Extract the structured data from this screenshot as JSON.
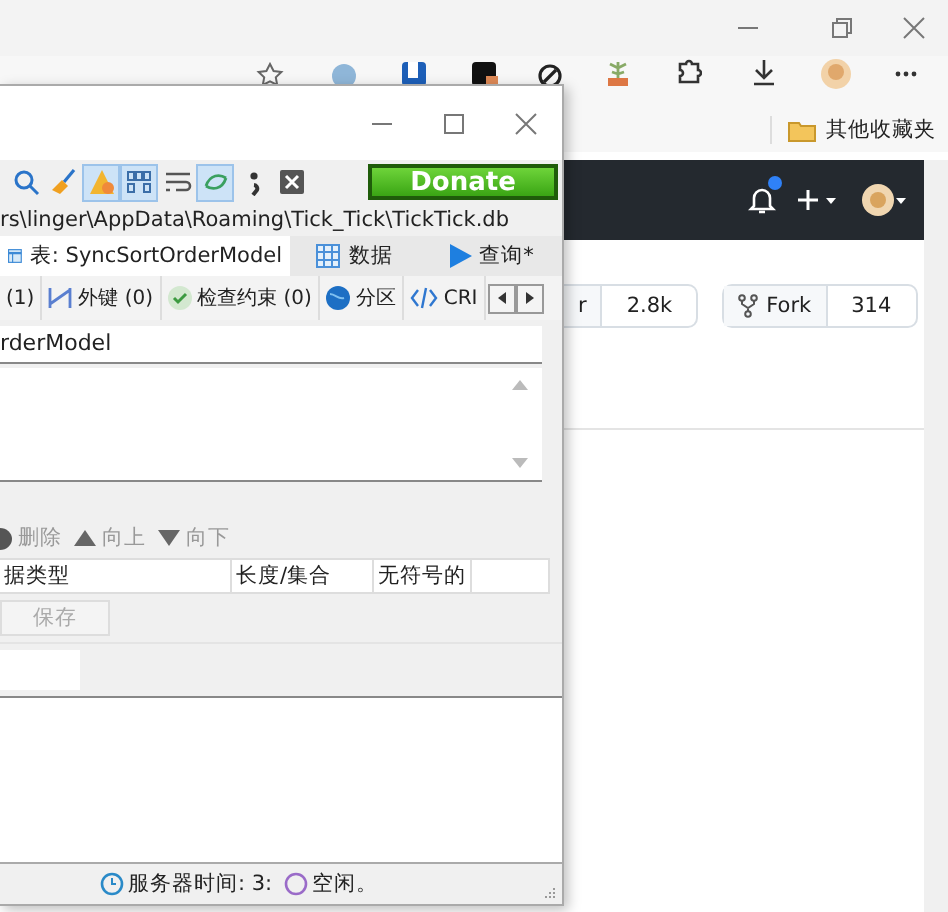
{
  "browser": {
    "bookmarks": [
      {
        "label": "其他收藏夹"
      }
    ],
    "github": {
      "notification_dot": true,
      "star_label": "r",
      "star_count": "2.8k",
      "fork_label": "Fork",
      "fork_count": "314"
    }
  },
  "heidisql": {
    "toolbar": [
      {
        "kind": "search",
        "on": false
      },
      {
        "kind": "broom",
        "on": false
      },
      {
        "kind": "warning",
        "on": true
      },
      {
        "kind": "binary",
        "on": true
      },
      {
        "kind": "wrap",
        "on": false
      },
      {
        "kind": "sync",
        "on": true
      },
      {
        "kind": "semicolon",
        "on": false
      },
      {
        "kind": "close",
        "on": false
      }
    ],
    "donate": "Donate",
    "path": "rs\\linger\\AppData\\Roaming\\Tick_Tick\\TickTick.db",
    "tabs": [
      {
        "kind": "table",
        "label": "表: SyncSortOrderModel",
        "selected": true
      },
      {
        "kind": "grid",
        "label": "数据",
        "selected": false
      },
      {
        "kind": "play",
        "label": "查询*",
        "selected": false
      }
    ],
    "subtabs": [
      {
        "kind": "none",
        "label": "(1)"
      },
      {
        "kind": "key",
        "label": "外键 (0)"
      },
      {
        "kind": "check",
        "label": "检查约束 (0)"
      },
      {
        "kind": "globe",
        "label": "分区"
      },
      {
        "kind": "code",
        "label": "CRI"
      }
    ],
    "name_value": "rderModel",
    "column_actions": [
      {
        "kind": "remove",
        "label": "删除",
        "disabled": true
      },
      {
        "kind": "up",
        "label": "向上",
        "disabled": true
      },
      {
        "kind": "down",
        "label": "向下",
        "disabled": true
      }
    ],
    "columns": [
      "据类型",
      "长度/集合",
      "无符号的"
    ],
    "save": {
      "label": "保存",
      "disabled": true
    },
    "status": [
      {
        "kind": "clock",
        "text": "服务器时间: 3:"
      },
      {
        "kind": "idle",
        "text": "空闲。"
      }
    ]
  }
}
